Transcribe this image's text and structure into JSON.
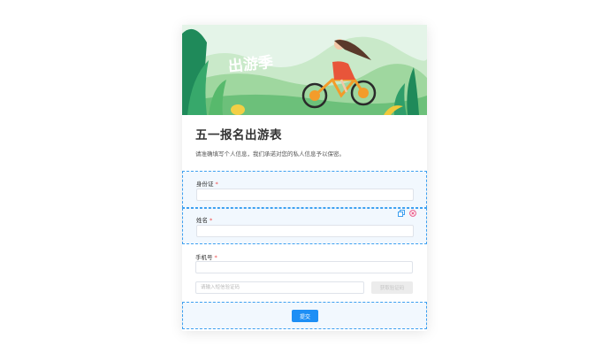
{
  "form": {
    "title": "五一报名出游表",
    "description": "请准确填写个人信息，我们承诺对您的私人信息予以保密。",
    "banner_text": "出游季",
    "fields": [
      {
        "label": "身份证",
        "required_mark": "*",
        "placeholder": ""
      },
      {
        "label": "姓名",
        "required_mark": "*",
        "placeholder": ""
      },
      {
        "label": "手机号",
        "required_mark": "*",
        "placeholder": ""
      }
    ],
    "sms_code": {
      "placeholder": "请输入短信验证码",
      "button_label": "获取验证码"
    },
    "submit_label": "提交"
  },
  "colors": {
    "accent": "#1e8ff5",
    "selection": "#3ea0f0",
    "required": "#f04848",
    "delete": "#e85a8a"
  }
}
